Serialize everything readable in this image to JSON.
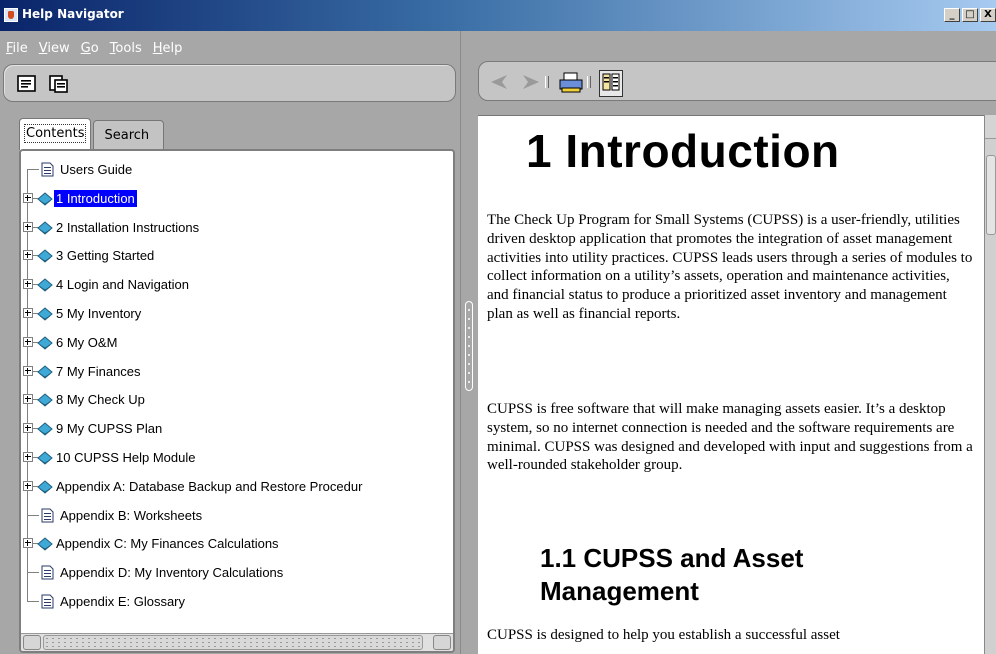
{
  "window": {
    "title": "Help Navigator",
    "controls": {
      "minimize": "_",
      "maximize": "□",
      "close": "X"
    }
  },
  "menu": [
    {
      "label": "File",
      "mnemonic": "F",
      "rest": "ile"
    },
    {
      "label": "View",
      "mnemonic": "V",
      "rest": "iew"
    },
    {
      "label": "Go",
      "mnemonic": "G",
      "rest": "o"
    },
    {
      "label": "Tools",
      "mnemonic": "T",
      "rest": "ools"
    },
    {
      "label": "Help",
      "mnemonic": "H",
      "rest": "elp"
    }
  ],
  "nav_tabs": [
    {
      "label": "Contents",
      "active": true
    },
    {
      "label": "Search",
      "active": false
    }
  ],
  "tree": {
    "items": [
      {
        "label": "Users Guide",
        "type": "page",
        "expandable": false,
        "selected": false
      },
      {
        "label": "1 Introduction",
        "type": "book",
        "expandable": true,
        "selected": true
      },
      {
        "label": "2 Installation Instructions",
        "type": "book",
        "expandable": true,
        "selected": false
      },
      {
        "label": "3 Getting Started",
        "type": "book",
        "expandable": true,
        "selected": false
      },
      {
        "label": "4 Login and Navigation",
        "type": "book",
        "expandable": true,
        "selected": false
      },
      {
        "label": "5 My Inventory",
        "type": "book",
        "expandable": true,
        "selected": false
      },
      {
        "label": "6 My O&M",
        "type": "book",
        "expandable": true,
        "selected": false
      },
      {
        "label": "7 My Finances",
        "type": "book",
        "expandable": true,
        "selected": false
      },
      {
        "label": "8 My Check Up",
        "type": "book",
        "expandable": true,
        "selected": false
      },
      {
        "label": "9 My CUPSS Plan",
        "type": "book",
        "expandable": true,
        "selected": false
      },
      {
        "label": "10 CUPSS Help Module",
        "type": "book",
        "expandable": true,
        "selected": false
      },
      {
        "label": "Appendix A: Database Backup and Restore Procedur",
        "type": "book",
        "expandable": true,
        "selected": false
      },
      {
        "label": "Appendix B: Worksheets",
        "type": "page",
        "expandable": false,
        "selected": false
      },
      {
        "label": "Appendix C: My Finances Calculations",
        "type": "book",
        "expandable": true,
        "selected": false
      },
      {
        "label": "Appendix D: My Inventory Calculations",
        "type": "page",
        "expandable": false,
        "selected": false
      },
      {
        "label": "Appendix E: Glossary",
        "type": "page",
        "expandable": false,
        "selected": false
      }
    ]
  },
  "toolbar_left": {
    "icons": [
      "hide-navigator-icon",
      "synchronize-icon"
    ]
  },
  "toolbar_right": {
    "icons": [
      "back-arrow-icon",
      "forward-arrow-icon",
      "print-icon",
      "page-setup-icon"
    ]
  },
  "document": {
    "heading": "1 Introduction",
    "paragraph1": "The Check Up Program for Small Systems (CUPSS) is a user-friendly, utilities driven desktop application that promotes the integration of asset management activities into utility practices.  CUPSS leads users through a series of modules to collect information on a utility’s assets, operation and maintenance activities, and financial status to produce a prioritized asset inventory and management plan as well as financial reports.",
    "paragraph2": "CUPSS is free software that will make managing assets easier.  It’s a desktop system, so no internet connection is needed and the software requirements are minimal.  CUPSS was designed and developed with input and suggestions from a well-rounded stakeholder group.",
    "subheading": "1.1 CUPSS and Asset Management",
    "paragraph3": "CUPSS is designed to help you establish a successful asset"
  },
  "colors": {
    "selection": "#0000ff",
    "chrome": "#a7a7a7",
    "book_icon": "#3fa9d6"
  }
}
